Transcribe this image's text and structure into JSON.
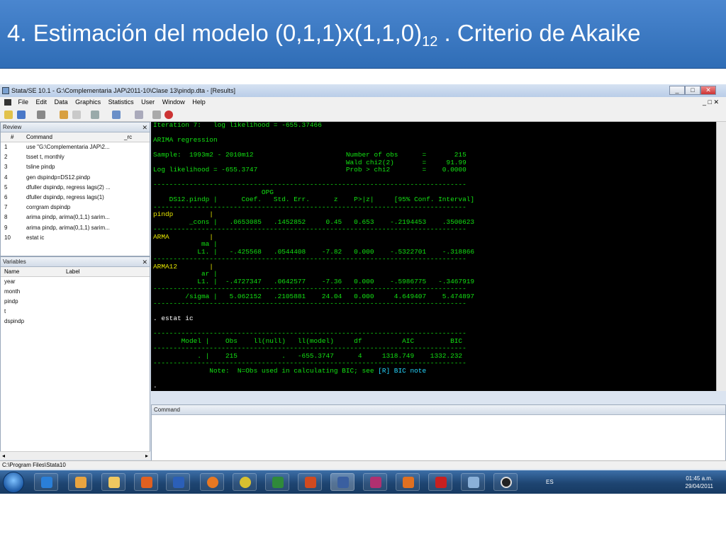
{
  "slide": {
    "title_main": "4. Estimación del modelo (0,1,1)x(1,1,0)",
    "title_sub": "12",
    "title_tail": " . Criterio de Akaike"
  },
  "window": {
    "title": "Stata/SE 10.1 - G:\\Complementaria JAP\\2011-10\\Clase 13\\pindp.dta - [Results]",
    "min": "_",
    "max": "□",
    "close": "✕"
  },
  "menu": [
    "File",
    "Edit",
    "Data",
    "Graphics",
    "Statistics",
    "User",
    "Window",
    "Help"
  ],
  "review": {
    "header": "Review",
    "close": "✕",
    "col_num": "#",
    "col_cmd": "Command",
    "col_rc": "_rc",
    "items": [
      {
        "n": "1",
        "cmd": "use \"G:\\Complementaria JAP\\2..."
      },
      {
        "n": "2",
        "cmd": "tsset t, monthly"
      },
      {
        "n": "3",
        "cmd": "tsline pindp"
      },
      {
        "n": "4",
        "cmd": "gen dspindp=DS12.pindp"
      },
      {
        "n": "5",
        "cmd": "dfuller dspindp, regress lags(2) ..."
      },
      {
        "n": "6",
        "cmd": "dfuller dspindp, regress lags(1)"
      },
      {
        "n": "7",
        "cmd": "corrgram dspindp"
      },
      {
        "n": "8",
        "cmd": "arima pindp, arima(0,1,1) sarim..."
      },
      {
        "n": "9",
        "cmd": "arima pindp, arima(0,1,1) sarim..."
      },
      {
        "n": "10",
        "cmd": "estat ic"
      }
    ]
  },
  "variables": {
    "header": "Variables",
    "close": "✕",
    "col_name": "Name",
    "col_label": "Label",
    "items": [
      "year",
      "month",
      "pindp",
      "t",
      "dspindp"
    ]
  },
  "results": {
    "iter": "Iteration 7:   log likelihood = -655.37466",
    "reg": "ARIMA regression",
    "s1": "Sample:  1993m2 - 2010m12                       Number of obs      =       215",
    "s2": "                                                Wald chi2(2)       =     91.99",
    "s3": "Log likelihood = -655.3747                      Prob > chi2        =    0.0000",
    "sep": "------------------------------------------------------------------------------",
    "h1": "                           OPG",
    "h2": "    DS12.pindp |      Coef.   Std. Err.      z    P>|z|     [95% Conf. Interval]",
    "pindp": "pindp         |",
    "cons": "         _cons |   .0653085   .1452852     0.45   0.653    -.2194453    .3500623",
    "arma": "ARMA          |",
    "ma": "            ma |",
    "maL1": "           L1. |   -.425568   .0544408    -7.82   0.000    -.5322701    -.318866",
    "arma12": "ARMA12        |",
    "ar": "            ar |",
    "arL1": "           L1. |  -.4727347   .0642577    -7.36   0.000    -.5986775   -.3467919",
    "sigma": "        /sigma |   5.062152   .2105881    24.04   0.000     4.649407    5.474897",
    "cmd": ". estat ic",
    "ich": "       Model |    Obs    ll(null)   ll(model)     df          AIC         BIC",
    "icr": "           . |    215           .   -655.3747      4     1318.749    1332.232",
    "note_pre": "              Note:  N=Obs used in calculating BIC; see ",
    "note_link": "[R] BIC note",
    "dot": "."
  },
  "command": {
    "header": "Command"
  },
  "status": {
    "path": "C:\\Program Files\\Stata10"
  },
  "taskbar": {
    "lang": "ES",
    "time": "01:45 a.m.",
    "date": "29/04/2011"
  }
}
